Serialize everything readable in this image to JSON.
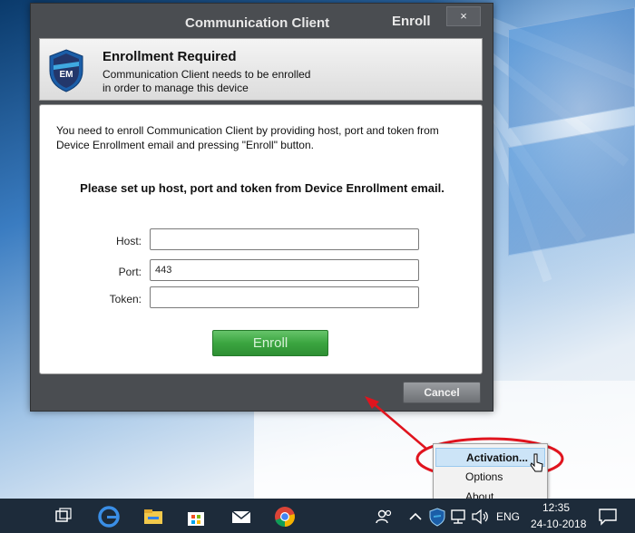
{
  "window": {
    "title": "Communication Client",
    "tab_label": "Enroll",
    "close_glyph": "×"
  },
  "header": {
    "logo_text": "EM",
    "title": "Enrollment Required",
    "line1": "Communication Client needs to be enrolled",
    "line2": "in order to manage this device"
  },
  "body": {
    "intro": "You need to enroll Communication Client by providing host, port and token from Device Enrollment email and pressing \"Enroll\" button.",
    "instruction": "Please set up host, port and token from Device Enrollment email.",
    "fields": {
      "host": {
        "label": "Host:",
        "value": ""
      },
      "port": {
        "label": "Port:",
        "value": "443"
      },
      "token": {
        "label": "Token:",
        "value": ""
      }
    },
    "enroll_button": "Enroll"
  },
  "footer": {
    "cancel_button": "Cancel"
  },
  "context_menu": {
    "items": [
      {
        "label": "Activation..."
      },
      {
        "label": "Options"
      },
      {
        "label": "About"
      }
    ]
  },
  "taskbar": {
    "language": "ENG",
    "time": "12:35",
    "date": "24-10-2018",
    "icons": [
      "task-view-icon",
      "edge-icon",
      "file-explorer-icon",
      "store-icon",
      "mail-icon",
      "chrome-icon",
      "people-icon",
      "show-hidden-icons-icon",
      "communication-client-tray-icon",
      "network-icon",
      "volume-icon",
      "action-center-icon"
    ]
  },
  "colors": {
    "window_bg": "#4a4d51",
    "enroll_green": "#3ba540",
    "annotation_red": "#e0141e",
    "menu_highlight": "#cce4f7"
  }
}
